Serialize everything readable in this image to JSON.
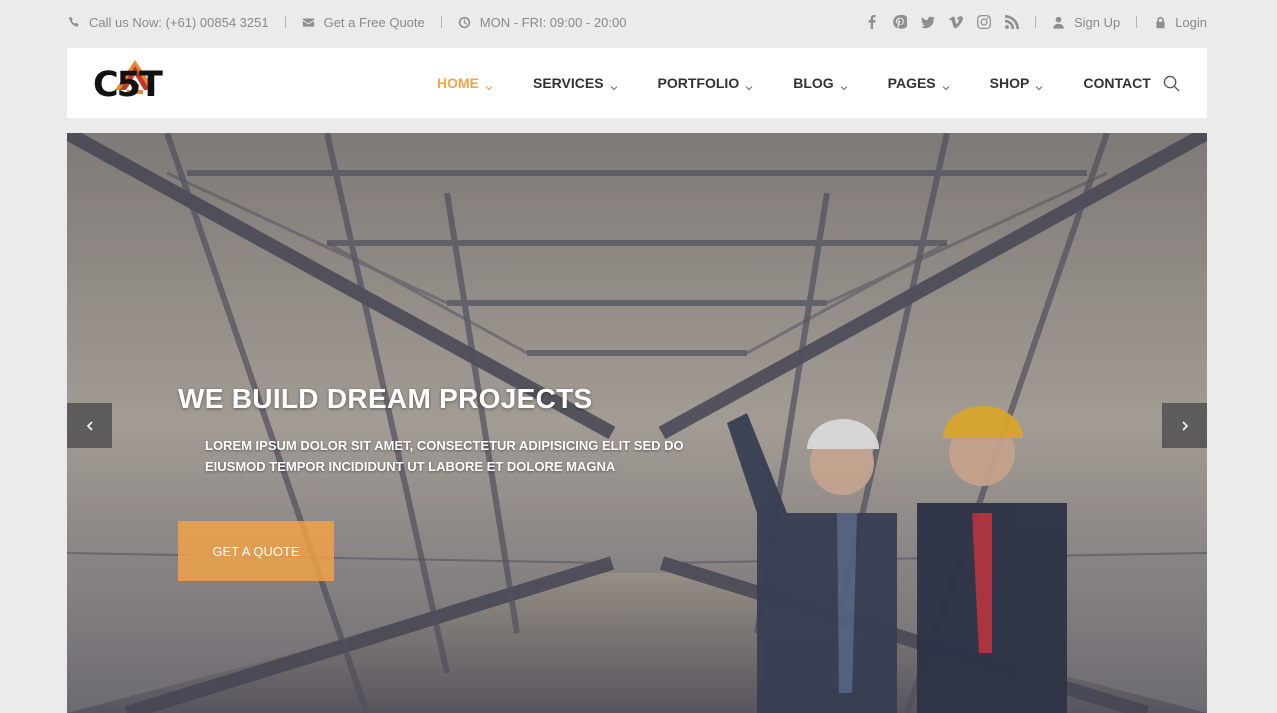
{
  "topbar": {
    "phone": "Call us Now: (+61) 00854 3251",
    "quote": "Get a Free Quote",
    "hours": "MON - FRI: 09:00 - 20:00",
    "signup": "Sign Up",
    "login": "Login",
    "social_icons": [
      "facebook-icon",
      "pinterest-icon",
      "twitter-icon",
      "vimeo-icon",
      "instagram-icon",
      "rss-icon"
    ]
  },
  "brand": {
    "logo_text": "C5T"
  },
  "nav": {
    "items": [
      {
        "label": "HOME",
        "active": true
      },
      {
        "label": "SERVICES"
      },
      {
        "label": "PORTFOLIO"
      },
      {
        "label": "BLOG"
      },
      {
        "label": "PAGES"
      },
      {
        "label": "SHOP"
      },
      {
        "label": "CONTACT"
      }
    ]
  },
  "hero": {
    "title": "WE BUILD DREAM PROJECTS",
    "subtitle": "LOREM IPSUM DOLOR SIT AMET, CONSECTETUR ADIPISICING ELIT SED DO EIUSMOD TEMPOR INCIDIDUNT UT LABORE ET DOLORE MAGNA",
    "button": "GET A QUOTE"
  },
  "colors": {
    "accent": "#f4a447",
    "text": "#333333",
    "muted": "#8a8a8a"
  }
}
